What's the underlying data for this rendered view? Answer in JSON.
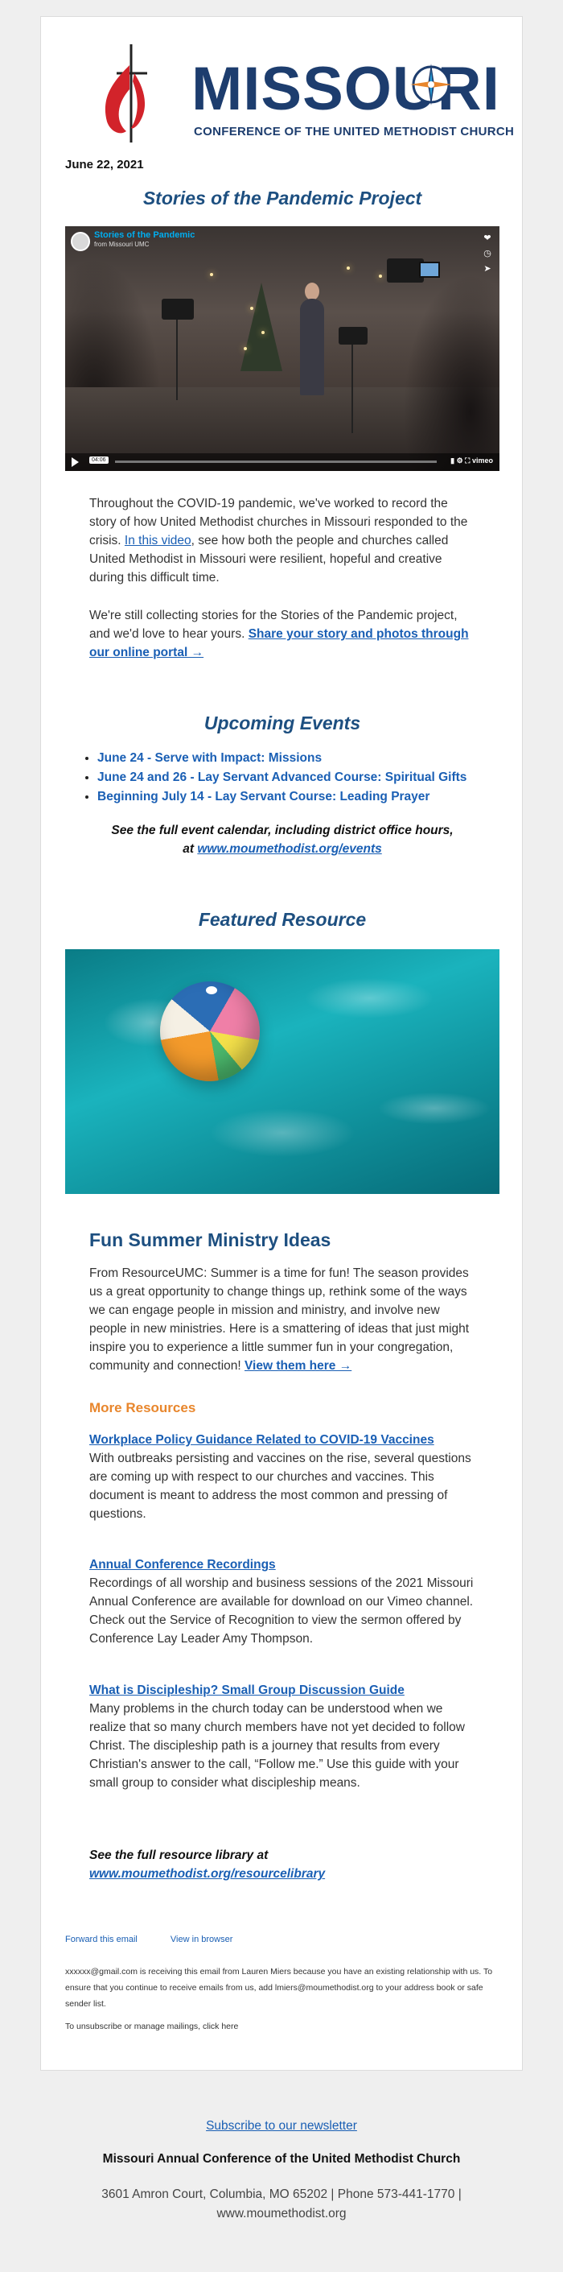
{
  "header": {
    "logo_title": "MISSOURI",
    "logo_subtitle": "CONFERENCE OF THE UNITED METHODIST CHURCH"
  },
  "date": "June 22, 2021",
  "pandemic": {
    "heading": "Stories of the Pandemic Project",
    "video": {
      "title": "Stories of the Pandemic",
      "from": "from Missouri UMC",
      "time": "04:06",
      "provider": "vimeo",
      "side_icons": [
        "heart-icon",
        "clock-icon",
        "share-icon"
      ]
    },
    "p1_before": "Throughout the COVID-19 pandemic, we've worked to record the story of how United Methodist churches in Missouri responded to the crisis. ",
    "p1_link": "In this video",
    "p1_after": ", see how both the people and churches called United Methodist in Missouri were resilient, hopeful and creative during this difficult time.",
    "p2_before": "We're still collecting stories for the Stories of the Pandemic project, and we'd love to hear yours. ",
    "p2_link": "Share your story and photos through our online portal →"
  },
  "events": {
    "heading": "Upcoming Events",
    "items": [
      "June 24 - Serve with Impact: Missions",
      "June 24 and 26 - Lay Servant Advanced Course: Spiritual Gifts",
      "Beginning July 14 - Lay Servant Course: Leading Prayer"
    ],
    "calendar_line1": "See the full event calendar, including district office hours,",
    "calendar_prefix": "at ",
    "calendar_link": "www.moumethodist.org/events"
  },
  "featured": {
    "heading": "Featured Resource",
    "title": "Fun Summer Ministry Ideas",
    "body": "From ResourceUMC: Summer is a time for fun! The season provides us a great opportunity to change things up, rethink some of the ways we can engage people in mission and ministry, and involve new people in new ministries. Here is a smattering of ideas that just might inspire you to experience a little summer fun in your congregation, community and connection! ",
    "body_link": "View them here →"
  },
  "more_resources": {
    "heading": "More Resources",
    "items": [
      {
        "title": "Workplace Policy Guidance Related to COVID-19 Vaccines",
        "body": "With outbreaks persisting and vaccines on the rise, several questions are coming up with respect to our churches and vaccines. This document is meant to address the most common and pressing of questions."
      },
      {
        "title": "Annual Conference Recordings",
        "body": "Recordings of all worship and business sessions of the 2021 Missouri Annual Conference are available for download on our Vimeo channel. Check out the Service of Recognition to view the sermon offered by Conference Lay Leader Amy Thompson."
      },
      {
        "title": "What is Discipleship? Small Group Discussion Guide",
        "body": "Many problems in the church today can be understood when we realize that so many church members have not yet decided to follow Christ. The discipleship path is a journey that results from every Christian's answer to the call, “Follow me.” Use this guide with your small group to consider what discipleship means."
      }
    ],
    "library_line": "See the full resource library at",
    "library_link": "www.moumethodist.org/resourcelibrary"
  },
  "email_footer": {
    "forward": "Forward this email",
    "view_browser": "View in browser",
    "notice": "xxxxxx@gmail.com is receiving this email from Lauren Miers because you have an existing relationship with us. To ensure that you continue to receive emails from us, add lmiers@moumethodist.org to your address book or safe sender list.",
    "unsubscribe": "To unsubscribe or manage mailings, click here"
  },
  "page_footer": {
    "subscribe": "Subscribe to our newsletter",
    "org": "Missouri Annual Conference of the United Methodist Church",
    "address": "3601 Amron Court, Columbia, MO 65202 | Phone 573-441-1770 |",
    "website": "www.moumethodist.org"
  },
  "colors": {
    "heading_blue": "#1d4f80",
    "link_blue": "#1a5fb4",
    "accent_orange": "#e8862c",
    "logo_navy": "#1d3d6e",
    "logo_red": "#d2232a"
  }
}
